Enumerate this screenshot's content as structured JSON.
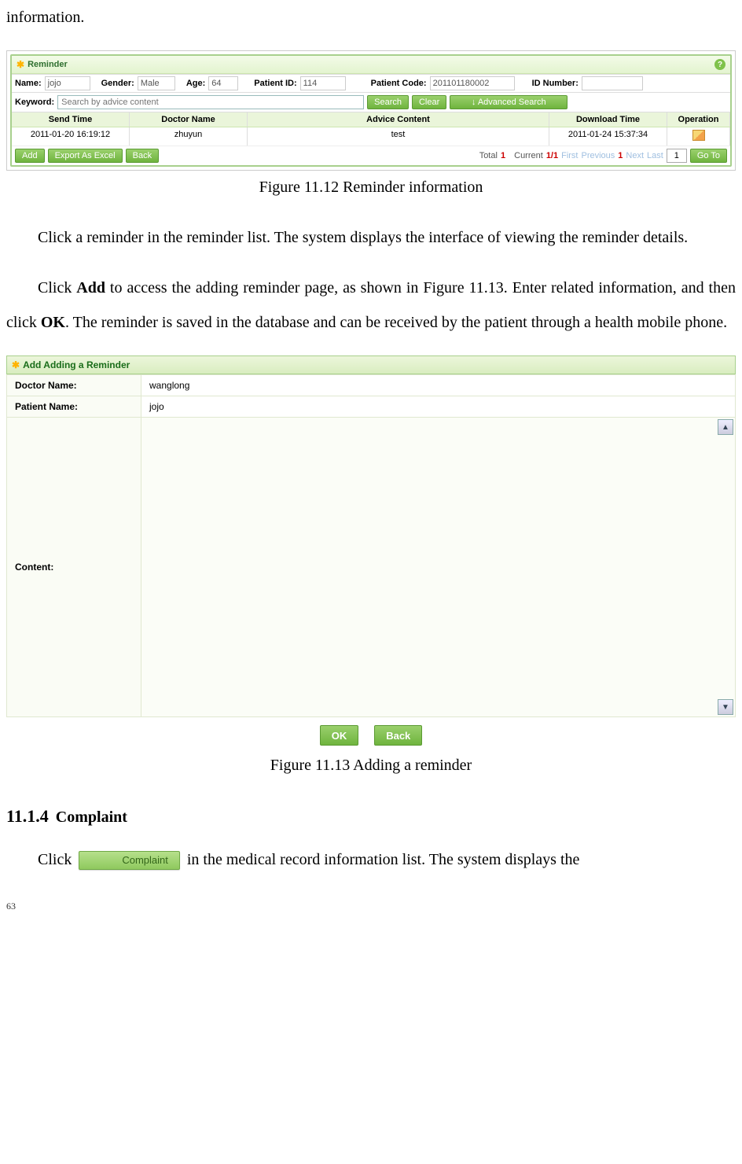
{
  "intro_text": "information.",
  "caption1": "Figure 11.12 Reminder information",
  "para1": "Click a reminder in the reminder list. The system displays the interface of viewing the reminder details.",
  "para2a": "Click ",
  "para2_add": "Add",
  "para2b": " to access the adding reminder page, as shown in Figure 11.13. Enter related information, and then click ",
  "para2_ok": "OK",
  "para2c": ". The reminder is saved in the database and can be received by the patient through a health mobile phone.",
  "caption2": "Figure 11.13 Adding a reminder",
  "section_num": "11.1.4",
  "section_title": "Complaint",
  "complaint_para_a": "Click ",
  "complaint_btn": "Complaint",
  "complaint_para_b": " in the medical record information list. The system displays the",
  "page_num": "63",
  "fig12": {
    "title": "Reminder",
    "labels": {
      "name": "Name:",
      "gender": "Gender:",
      "age": "Age:",
      "pid": "Patient ID:",
      "pcode": "Patient Code:",
      "idn": "ID Number:",
      "keyword": "Keyword:"
    },
    "vals": {
      "name": "jojo",
      "gender": "Male",
      "age": "64",
      "pid": "114",
      "pcode": "201101180002",
      "idn": ""
    },
    "kw_placeholder": "Search by advice content",
    "buttons": {
      "search": "Search",
      "clear": "Clear",
      "adv": "↓ Advanced Search",
      "add": "Add",
      "export": "Export As Excel",
      "back": "Back",
      "goto": "Go To"
    },
    "columns": {
      "send": "Send Time",
      "doctor": "Doctor Name",
      "advice": "Advice Content",
      "download": "Download Time",
      "op": "Operation"
    },
    "row": {
      "send": "2011-01-20 16:19:12",
      "doctor": "zhuyun",
      "advice": "test",
      "download": "2011-01-24 15:37:34"
    },
    "pager": {
      "total_lbl": "Total",
      "total_val": "1",
      "current_lbl": "Current",
      "current_val": "1/1",
      "first": "First",
      "prev": "Previous",
      "page": "1",
      "next": "Next",
      "last": "Last",
      "goto_val": "1"
    }
  },
  "fig13": {
    "title": "Add Adding a Reminder",
    "labels": {
      "doctor": "Doctor Name:",
      "patient": "Patient Name:",
      "content": "Content:"
    },
    "vals": {
      "doctor": "wanglong",
      "patient": "jojo"
    },
    "buttons": {
      "ok": "OK",
      "back": "Back"
    }
  }
}
